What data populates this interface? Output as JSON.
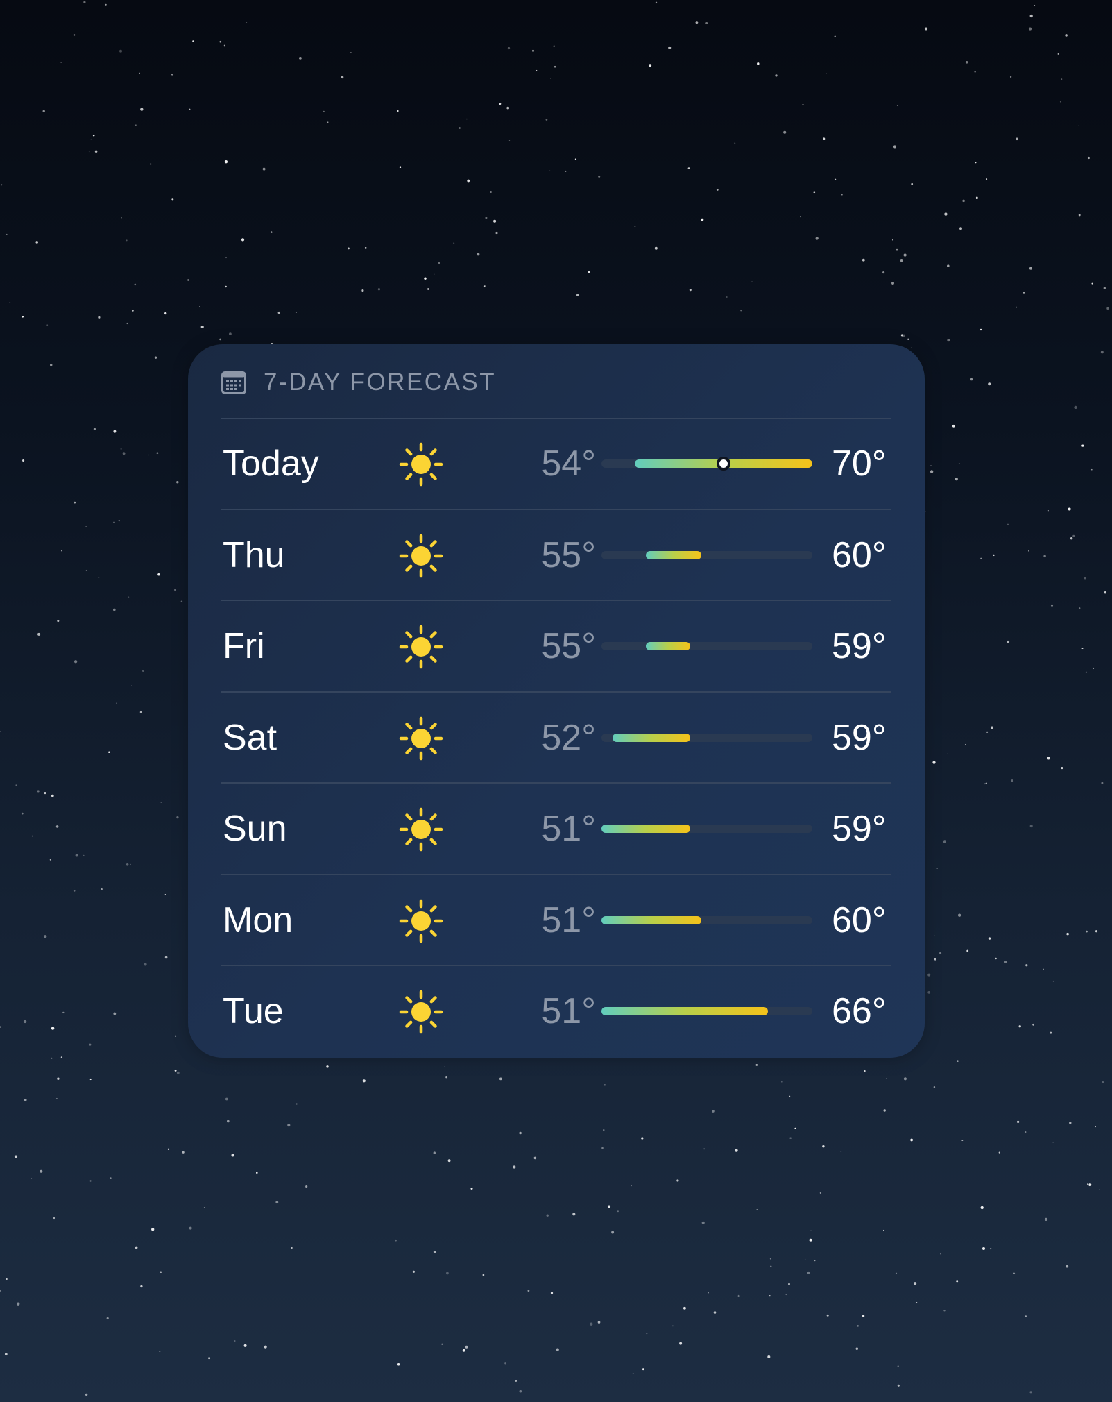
{
  "forecast": {
    "title": "7-DAY FORECAST",
    "header_icon": "calendar-icon",
    "scale_min": 51,
    "scale_max": 70,
    "colors": {
      "bar_cool": "#62cdbd",
      "bar_mid": "#b8cf4a",
      "bar_warm": "#f5c21a",
      "sun": "#fbd434"
    },
    "days": [
      {
        "day": "Today",
        "icon": "sun-icon",
        "low": "54°",
        "high": "70°",
        "low_value": 54,
        "high_value": 70,
        "current_value": 62
      },
      {
        "day": "Thu",
        "icon": "sun-icon",
        "low": "55°",
        "high": "60°",
        "low_value": 55,
        "high_value": 60
      },
      {
        "day": "Fri",
        "icon": "sun-icon",
        "low": "55°",
        "high": "59°",
        "low_value": 55,
        "high_value": 59
      },
      {
        "day": "Sat",
        "icon": "sun-icon",
        "low": "52°",
        "high": "59°",
        "low_value": 52,
        "high_value": 59
      },
      {
        "day": "Sun",
        "icon": "sun-icon",
        "low": "51°",
        "high": "59°",
        "low_value": 51,
        "high_value": 59
      },
      {
        "day": "Mon",
        "icon": "sun-icon",
        "low": "51°",
        "high": "60°",
        "low_value": 51,
        "high_value": 60
      },
      {
        "day": "Tue",
        "icon": "sun-icon",
        "low": "51°",
        "high": "66°",
        "low_value": 51,
        "high_value": 66
      }
    ]
  }
}
